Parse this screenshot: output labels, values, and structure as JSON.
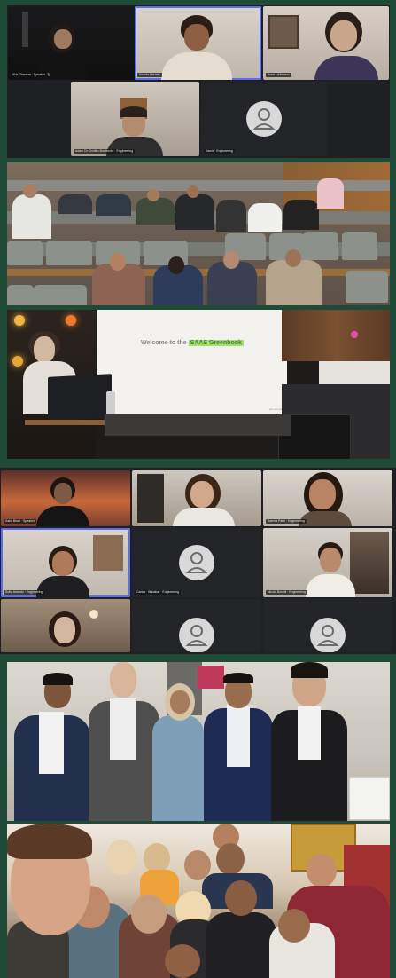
{
  "meeting1": {
    "participants": [
      {
        "name": "Ahir Ghanem · Speaker"
      },
      {
        "name": "Andrés Hernán"
      },
      {
        "name": "Anne Liebmann"
      },
      {
        "name": "Adam Dr. Guillén-Borderzkz · Engineering"
      },
      {
        "name": "Samir · Engineering"
      }
    ]
  },
  "meeting2": {
    "participants": [
      {
        "name": "Sahil Bhatt · Speaker"
      },
      {
        "name": ""
      },
      {
        "name": "Samira Patel · Engineering"
      },
      {
        "name": "Sofia Antonio · Engineering"
      },
      {
        "name": "Carlos · Bubakar · Engineering"
      },
      {
        "name": "Nicolo Bonelli · Engineering"
      },
      {
        "name": ""
      },
      {
        "name": ""
      },
      {
        "name": ""
      }
    ]
  },
  "presentation": {
    "slide_text_prefix": "Welcome to the",
    "slide_text_highlight": "SAAS Greenbook",
    "slide_footer": "greenbook"
  },
  "colors": {
    "background": "#1f4a38",
    "tile_dark": "#2b2d31",
    "avatar": "#d8d8d8",
    "highlight": "#9be36b",
    "active_speaker": "#5b6df0"
  },
  "icons": {
    "avatar": "person-avatar-icon",
    "mic": "mic-off-icon"
  }
}
